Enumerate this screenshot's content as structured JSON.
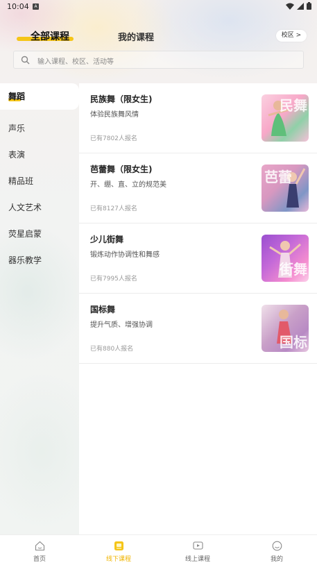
{
  "status_bar": {
    "time": "10:04",
    "notif_letter": "A"
  },
  "header": {
    "tabs": [
      {
        "label": "全部课程",
        "active": true
      },
      {
        "label": "我的课程",
        "active": false
      }
    ],
    "campus_button": "校区 >",
    "search_placeholder": "输入课程、校区、活动等"
  },
  "sidebar": {
    "items": [
      {
        "label": "舞蹈",
        "active": true
      },
      {
        "label": "声乐"
      },
      {
        "label": "表演"
      },
      {
        "label": "精品班"
      },
      {
        "label": "人文艺术"
      },
      {
        "label": "荧星启蒙"
      },
      {
        "label": "器乐教学"
      }
    ]
  },
  "courses": [
    {
      "name": "民族舞（限女生)",
      "desc": "体验民族舞风情",
      "count": "已有7802人报名",
      "thumb_text": "民舞",
      "thumb_colors": [
        "#f7b6d0",
        "#8fd0a8"
      ]
    },
    {
      "name": "芭蕾舞（限女生)",
      "desc": "开、绷、直、立的规范美",
      "count": "已有8127人报名",
      "thumb_text": "芭蕾",
      "thumb_colors": [
        "#e8a6c8",
        "#6f8fc0"
      ]
    },
    {
      "name": "少儿街舞",
      "desc": "锻炼动作协调性和舞感",
      "count": "已有7995人报名",
      "thumb_text": "街舞",
      "thumb_colors": [
        "#b06ad6",
        "#f48ccf"
      ]
    },
    {
      "name": "国标舞",
      "desc": "提升气质、增强协调",
      "count": "已有880人报名",
      "thumb_text": "国标",
      "thumb_colors": [
        "#c9a0c8",
        "#e25a6a"
      ]
    }
  ],
  "bottom_nav": {
    "items": [
      {
        "label": "首页",
        "icon": "home-icon"
      },
      {
        "label": "线下课程",
        "icon": "offline-course-icon",
        "active": true
      },
      {
        "label": "线上课程",
        "icon": "online-course-icon"
      },
      {
        "label": "我的",
        "icon": "profile-icon"
      }
    ]
  },
  "colors": {
    "accent": "#f5c518",
    "active_nav": "#f0b400"
  }
}
